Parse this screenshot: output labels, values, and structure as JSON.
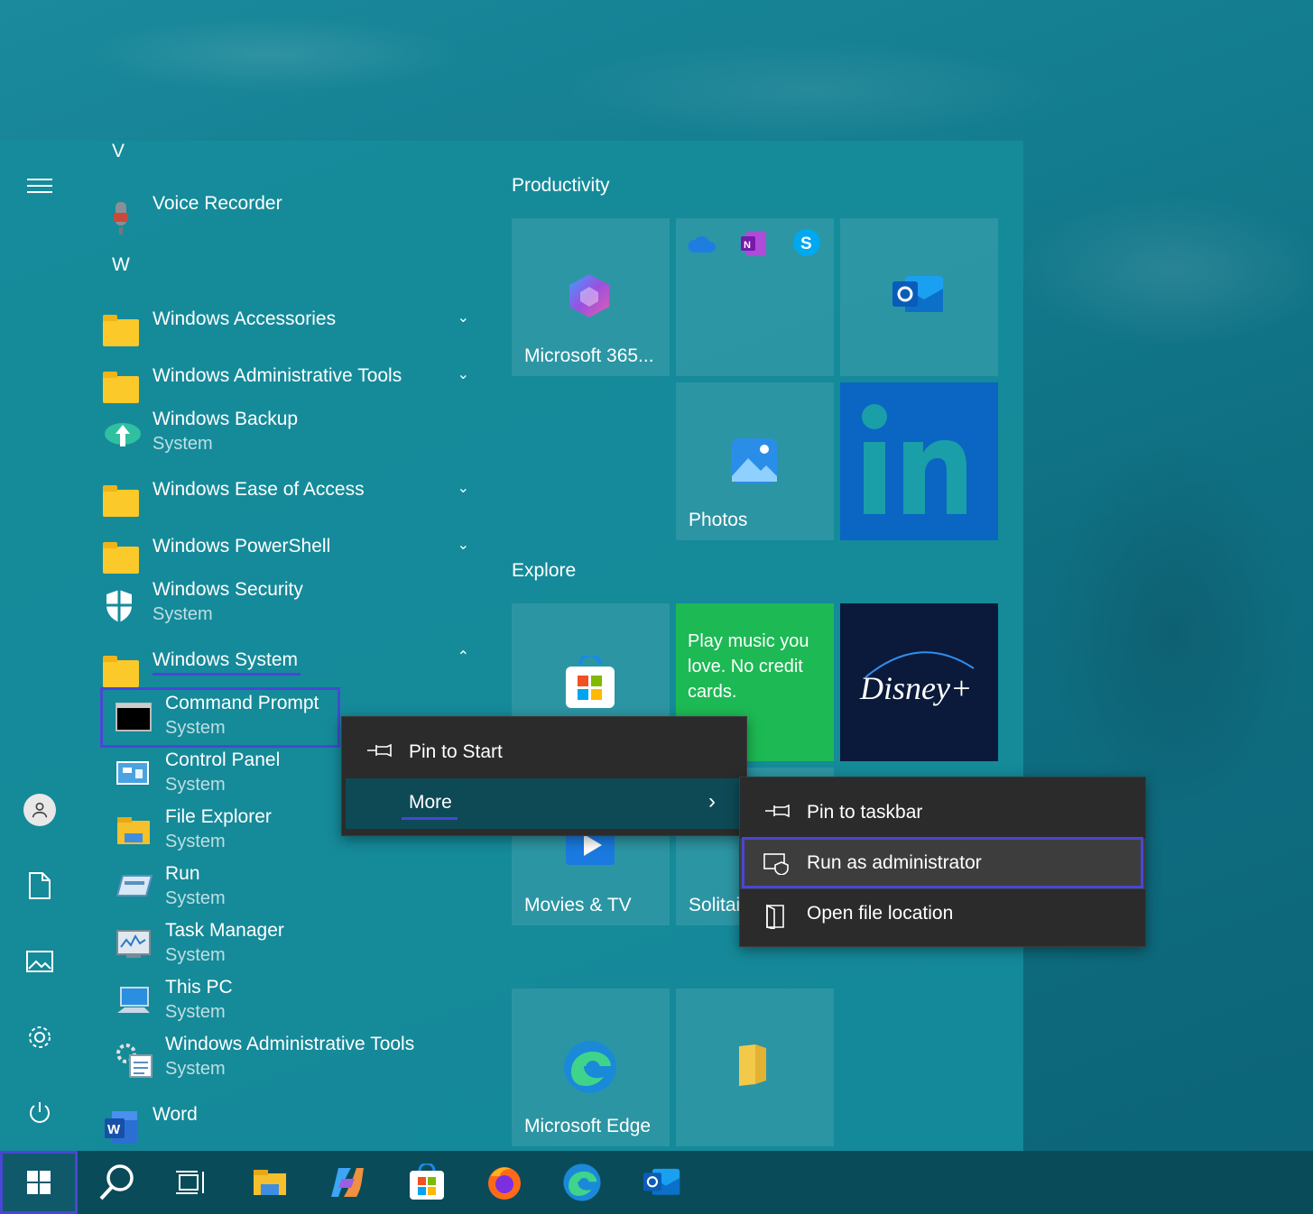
{
  "app_list": {
    "letter_v": "V",
    "letter_w": "W",
    "items": [
      {
        "name": "Voice Recorder",
        "sub": ""
      },
      {
        "name": "Windows Accessories",
        "sub": ""
      },
      {
        "name": "Windows Administrative Tools",
        "sub": ""
      },
      {
        "name": "Windows Backup",
        "sub": "System"
      },
      {
        "name": "Windows Ease of Access",
        "sub": ""
      },
      {
        "name": "Windows PowerShell",
        "sub": ""
      },
      {
        "name": "Windows Security",
        "sub": "System"
      },
      {
        "name": "Windows System",
        "sub": ""
      },
      {
        "name": "Command Prompt",
        "sub": "System"
      },
      {
        "name": "Control Panel",
        "sub": "System"
      },
      {
        "name": "File Explorer",
        "sub": "System"
      },
      {
        "name": "Run",
        "sub": "System"
      },
      {
        "name": "Task Manager",
        "sub": "System"
      },
      {
        "name": "This PC",
        "sub": "System"
      },
      {
        "name": "Windows Administrative Tools",
        "sub": "System"
      },
      {
        "name": "Word",
        "sub": ""
      }
    ]
  },
  "tiles": {
    "group_productivity": "Productivity",
    "group_explore": "Explore",
    "microsoft365": "Microsoft 365...",
    "photos": "Photos",
    "spotify_text": "Play music you love. No credit cards.",
    "disney": "Disney+",
    "movies": "Movies & TV",
    "solitaire": "Solitai",
    "edge": "Microsoft Edge"
  },
  "context_menu": {
    "pin_to_start": "Pin to Start",
    "more": "More"
  },
  "submenu": {
    "pin_to_taskbar": "Pin to taskbar",
    "run_as_admin": "Run as administrator",
    "open_file_location": "Open file location"
  },
  "colors": {
    "highlight": "#4a46d4",
    "linkedin": "#0a66c2",
    "spotify": "#1db954",
    "disney": "#0b1a3a"
  }
}
